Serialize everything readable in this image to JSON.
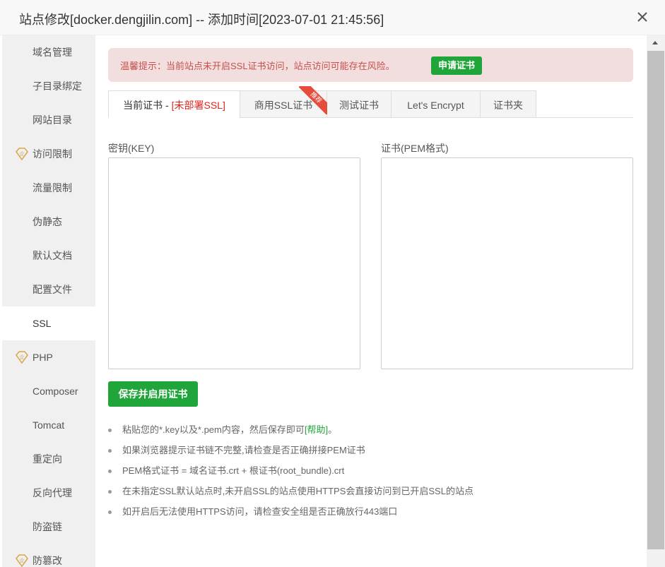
{
  "dialog": {
    "title": "站点修改[docker.dengjilin.com] -- 添加时间[2023-07-01 21:45:56]",
    "close_icon": "close-icon"
  },
  "sidebar": {
    "items": [
      {
        "label": "域名管理",
        "pro": false,
        "active": false
      },
      {
        "label": "子目录绑定",
        "pro": false,
        "active": false
      },
      {
        "label": "网站目录",
        "pro": false,
        "active": false
      },
      {
        "label": "访问限制",
        "pro": true,
        "active": false
      },
      {
        "label": "流量限制",
        "pro": false,
        "active": false
      },
      {
        "label": "伪静态",
        "pro": false,
        "active": false
      },
      {
        "label": "默认文档",
        "pro": false,
        "active": false
      },
      {
        "label": "配置文件",
        "pro": false,
        "active": false
      },
      {
        "label": "SSL",
        "pro": false,
        "active": true
      },
      {
        "label": "PHP",
        "pro": true,
        "active": false
      },
      {
        "label": "Composer",
        "pro": false,
        "active": false
      },
      {
        "label": "Tomcat",
        "pro": false,
        "active": false
      },
      {
        "label": "重定向",
        "pro": false,
        "active": false
      },
      {
        "label": "反向代理",
        "pro": false,
        "active": false
      },
      {
        "label": "防盗链",
        "pro": false,
        "active": false
      },
      {
        "label": "防篡改",
        "pro": true,
        "active": false
      }
    ]
  },
  "warning": {
    "text": "温馨提示：当前站点未开启SSL证书访问，站点访问可能存在风险。",
    "button": "申请证书"
  },
  "tabs": [
    {
      "label": "当前证书 - ",
      "status": "[未部署SSL]",
      "active": true
    },
    {
      "label": "商用SSL证书",
      "ribbon": "推荐",
      "active": false
    },
    {
      "label": "测试证书",
      "active": false
    },
    {
      "label": "Let's Encrypt",
      "active": false
    },
    {
      "label": "证书夹",
      "active": false
    }
  ],
  "key_field": {
    "label": "密钥(KEY)",
    "value": ""
  },
  "cert_field": {
    "label": "证书(PEM格式)",
    "value": ""
  },
  "save_button": "保存并启用证书",
  "tips": {
    "tip1_prefix": "粘贴您的*.key以及*.pem内容，然后保存即可",
    "tip1_link": "[帮助]",
    "tip1_suffix": "。",
    "tip2": "如果浏览器提示证书链不完整,请检查是否正确拼接PEM证书",
    "tip3": "PEM格式证书 = 域名证书.crt + 根证书(root_bundle).crt",
    "tip4": "在未指定SSL默认站点时,未开启SSL的站点使用HTTPS会直接访问到已开启SSL的站点",
    "tip5": "如开启后无法使用HTTPS访问，请检查安全组是否正确放行443端口"
  },
  "colors": {
    "accent": "#20a53a",
    "warning_bg": "#f2dede",
    "warning_text": "#c7504b",
    "status_red": "#e1241b",
    "ribbon": "#e64c3c"
  }
}
